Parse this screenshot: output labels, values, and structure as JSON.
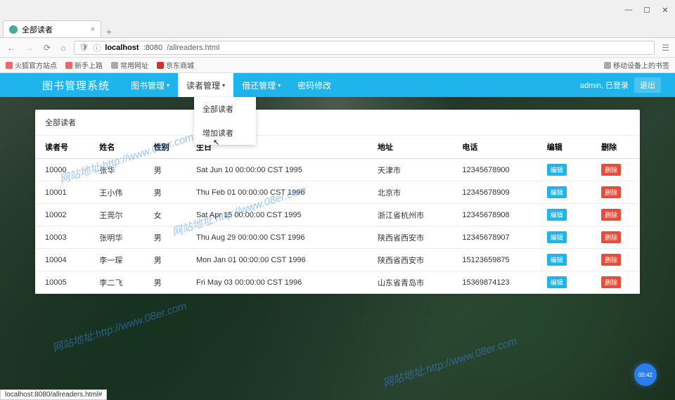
{
  "browser": {
    "tab_title": "全部读者",
    "url_host": "localhost",
    "url_port": ":8080",
    "url_path": "/allreaders.html",
    "status_url": "localhost:8080/allreaders.html#",
    "bookmarks": [
      "火狐官方站点",
      "新手上路",
      "常用网址",
      "京东商城"
    ],
    "right_bookmark": "移动设备上的书签"
  },
  "nav": {
    "brand": "图书管理系统",
    "items": [
      "图书管理",
      "读者管理",
      "借还管理",
      "密码修改"
    ],
    "user_info": "admin, 已登录",
    "logout": "退出"
  },
  "dropdown": {
    "items": [
      "全部读者",
      "增加读者"
    ]
  },
  "panel_title": "全部读者",
  "table": {
    "headers": [
      "读者号",
      "姓名",
      "性别",
      "生日",
      "地址",
      "电话",
      "编辑",
      "删除"
    ],
    "rows": [
      {
        "id": "10000",
        "name": "张华",
        "gender": "男",
        "birth": "Sat Jun 10 00:00:00 CST 1995",
        "addr": "天津市",
        "phone": "12345678900"
      },
      {
        "id": "10001",
        "name": "王小伟",
        "gender": "男",
        "birth": "Thu Feb 01 00:00:00 CST 1996",
        "addr": "北京市",
        "phone": "12345678909"
      },
      {
        "id": "10002",
        "name": "王莞尔",
        "gender": "女",
        "birth": "Sat Apr 15 00:00:00 CST 1995",
        "addr": "浙江省杭州市",
        "phone": "12345678908"
      },
      {
        "id": "10003",
        "name": "张明华",
        "gender": "男",
        "birth": "Thu Aug 29 00:00:00 CST 1996",
        "addr": "陕西省西安市",
        "phone": "12345678907"
      },
      {
        "id": "10004",
        "name": "李一琛",
        "gender": "男",
        "birth": "Mon Jan 01 00:00:00 CST 1996",
        "addr": "陕西省西安市",
        "phone": "15123659875"
      },
      {
        "id": "10005",
        "name": "李二飞",
        "gender": "男",
        "birth": "Fri May 03 00:00:00 CST 1996",
        "addr": "山东省青岛市",
        "phone": "15369874123"
      }
    ],
    "edit_label": "编辑",
    "del_label": "删除"
  },
  "watermark": "网站地址:http://www.08er.com",
  "timer": "00:42"
}
